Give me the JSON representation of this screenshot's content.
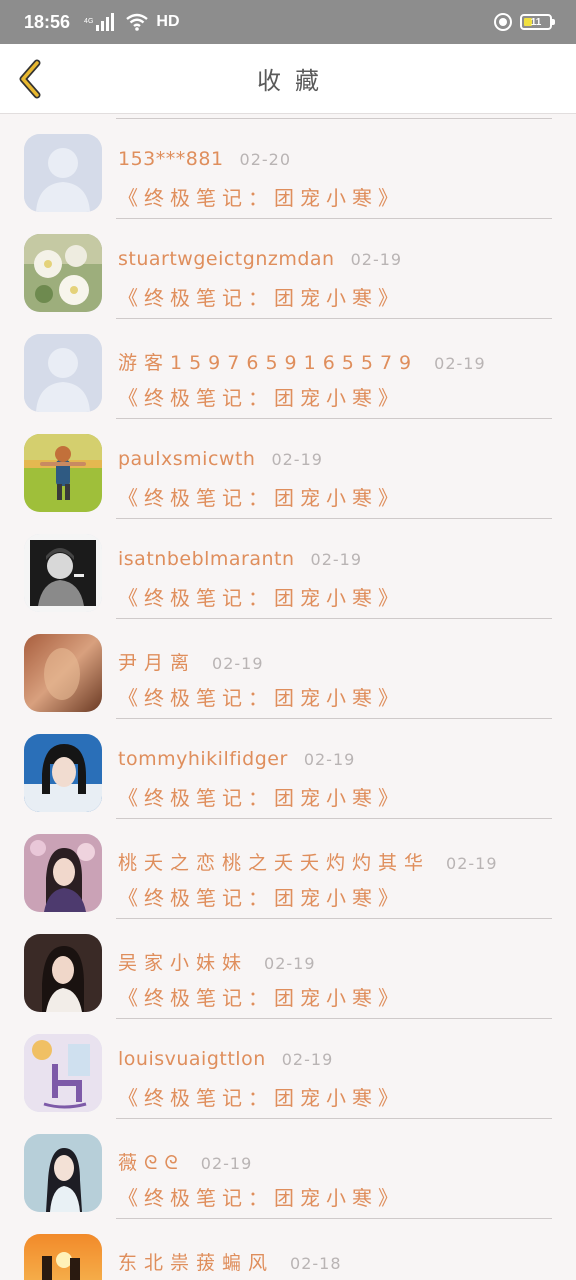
{
  "status_bar": {
    "time": "18:56",
    "network": "4G",
    "hd": "HD",
    "battery": "11"
  },
  "nav": {
    "title": "收藏"
  },
  "colors": {
    "accent": "#df8e5c",
    "date": "#b9b4b4",
    "back_arrow": "#e8b830"
  },
  "items": [
    {
      "username": "153***881",
      "date": "02-20",
      "book": "《终极笔记：团宠小寒》",
      "avatar": "default-avatar"
    },
    {
      "username": "stuartwgeictgnzmdan",
      "date": "02-19",
      "book": "《终极笔记：团宠小寒》",
      "avatar": "white-flowers-photo"
    },
    {
      "username": "游客1597659165579",
      "date": "02-19",
      "book": "《终极笔记：团宠小寒》",
      "avatar": "default-avatar"
    },
    {
      "username": "paulxsmicwth",
      "date": "02-19",
      "book": "《终极笔记：团宠小寒》",
      "avatar": "child-on-grass-photo"
    },
    {
      "username": "isatnbeblmarantn",
      "date": "02-19",
      "book": "《终极笔记：团宠小寒》",
      "avatar": "black-white-portrait"
    },
    {
      "username": "尹月离",
      "date": "02-19",
      "book": "《终极笔记：团宠小寒》",
      "avatar": "warm-blur-photo"
    },
    {
      "username": "tommyhikilfidger",
      "date": "02-19",
      "book": "《终极笔记：团宠小寒》",
      "avatar": "girl-portrait-blue"
    },
    {
      "username": "桃夭之恋桃之夭夭灼灼其华",
      "date": "02-19",
      "book": "《终极笔记：团宠小寒》",
      "avatar": "girl-pink-blossoms"
    },
    {
      "username": "吴家小妹妹",
      "date": "02-19",
      "book": "《终极笔记：团宠小寒》",
      "avatar": "girl-dark-portrait"
    },
    {
      "username": "louisvuaigttlon",
      "date": "02-19",
      "book": "《终极笔记：团宠小寒》",
      "avatar": "chair-illustration"
    },
    {
      "username": "薇ᘓᘓ",
      "date": "02-19",
      "book": "《终极笔记：团宠小寒》",
      "avatar": "girl-hanfu-photo"
    },
    {
      "username": "东北祟菝蝙风",
      "date": "02-18",
      "book": "",
      "avatar": "sunset-couple-photo"
    }
  ]
}
